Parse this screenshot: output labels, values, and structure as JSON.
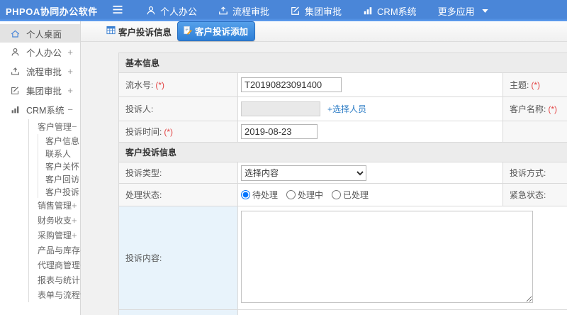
{
  "colors": {
    "topbar": "#4a86d8",
    "active_tab": "#2e7fd6",
    "required": "#e34545",
    "link": "#2d7dc6"
  },
  "topbar": {
    "logo": "PHPOA协同办公软件",
    "nav": [
      {
        "label": "个人办公",
        "icon": "person-icon"
      },
      {
        "label": "流程审批",
        "icon": "flow-icon"
      },
      {
        "label": "集团审批",
        "icon": "edit-icon"
      },
      {
        "label": "CRM系统",
        "icon": "chart-icon"
      },
      {
        "label": "更多应用",
        "icon": "caret-down-icon"
      }
    ]
  },
  "sidebar": {
    "top_items": [
      {
        "label": "个人桌面",
        "icon": "home-icon",
        "expand": ""
      },
      {
        "label": "个人办公",
        "icon": "person-icon",
        "expand": "+"
      },
      {
        "label": "流程审批",
        "icon": "flow-icon",
        "expand": "+"
      },
      {
        "label": "集团审批",
        "icon": "edit-icon",
        "expand": "+"
      },
      {
        "label": "CRM系统",
        "icon": "chart-icon",
        "expand": "−"
      }
    ],
    "customer_group": {
      "label": "客户管理",
      "expand": "−"
    },
    "customer_items": [
      "客户信息",
      "联系人",
      "客户关怀",
      "客户回访",
      "客户投诉"
    ],
    "other_groups": [
      {
        "label": "销售管理",
        "expand": "+"
      },
      {
        "label": "财务收支",
        "expand": "+"
      },
      {
        "label": "采购管理",
        "expand": "+"
      },
      {
        "label": "产品与库存",
        "expand": "+"
      },
      {
        "label": "代理商管理",
        "expand": "+"
      },
      {
        "label": "报表与统计",
        "expand": ""
      },
      {
        "label": "表单与流程设置",
        "expand": "+"
      }
    ]
  },
  "tabs": {
    "info": {
      "label": "客户投诉信息"
    },
    "add": {
      "label": "客户投诉添加"
    }
  },
  "form": {
    "section1_title": "基本信息",
    "section2_title": "客户投诉信息",
    "fields": {
      "serial": {
        "label": "流水号:",
        "required": "(*)",
        "value": "T20190823091400"
      },
      "subject": {
        "label": "主题:",
        "required": "(*)"
      },
      "complainant": {
        "label": "投诉人:",
        "value": "",
        "picker_link": "+选择人员"
      },
      "customer_name": {
        "label": "客户名称:",
        "required": "(*)"
      },
      "complaint_time": {
        "label": "投诉时间:",
        "required": "(*)",
        "value": "2019-08-23"
      },
      "complaint_type": {
        "label": "投诉类型:",
        "selected": "选择内容"
      },
      "complaint_method": {
        "label": "投诉方式:"
      },
      "handle_status": {
        "label": "处理状态:",
        "options": [
          "待处理",
          "处理中",
          "已处理"
        ],
        "checked": "待处理"
      },
      "urgent_status": {
        "label": "紧急状态:"
      },
      "complaint_content": {
        "label": "投诉内容:"
      }
    }
  }
}
